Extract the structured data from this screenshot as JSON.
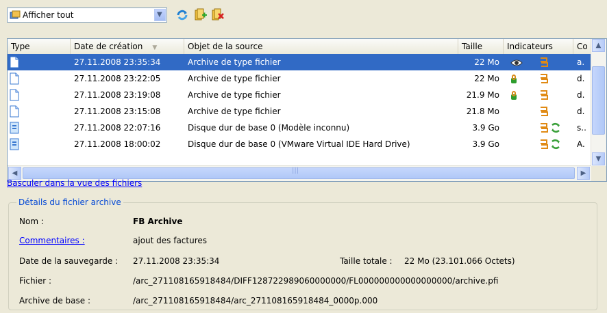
{
  "toolbar": {
    "filter_value": "Afficher tout",
    "icons": [
      "refresh-icon",
      "add-archive-icon",
      "delete-archive-icon"
    ]
  },
  "table": {
    "columns": [
      "Type",
      "Date de création",
      "Objet de la source",
      "Taille",
      "Indicateurs",
      "Co"
    ],
    "rows": [
      {
        "date": "27.11.2008 23:35:34",
        "object": "Archive de type fichier",
        "size": "22 Mo",
        "extra": "a.",
        "selected": true,
        "icon": "file-archive-icon",
        "indicators": [
          "hide-icon",
          "chain-icon"
        ]
      },
      {
        "date": "27.11.2008 23:22:05",
        "object": "Archive de type fichier",
        "size": "22 Mo",
        "extra": "d.",
        "selected": false,
        "icon": "file-archive-icon",
        "indicators": [
          "lock-icon",
          "chain-icon"
        ]
      },
      {
        "date": "27.11.2008 23:19:08",
        "object": "Archive de type fichier",
        "size": "21.9 Mo",
        "extra": "d.",
        "selected": false,
        "icon": "file-archive-icon",
        "indicators": [
          "lock-icon",
          "chain-icon"
        ]
      },
      {
        "date": "27.11.2008 23:15:08",
        "object": "Archive de type fichier",
        "size": "21.8 Mo",
        "extra": "d.",
        "selected": false,
        "icon": "file-archive-icon",
        "indicators": [
          "chain-icon"
        ]
      },
      {
        "date": "27.11.2008 22:07:16",
        "object": "Disque dur de base 0 (Modèle inconnu)",
        "size": "3.9 Go",
        "extra": "s..",
        "selected": false,
        "icon": "disk-archive-icon",
        "indicators": [
          "chain-icon",
          "recycle-icon"
        ]
      },
      {
        "date": "27.11.2008 18:00:02",
        "object": "Disque dur de base 0 (VMware Virtual IDE Hard Drive)",
        "size": "3.9 Go",
        "extra": "A.",
        "selected": false,
        "icon": "disk-archive-icon",
        "indicators": [
          "chain-icon",
          "recycle-icon"
        ]
      }
    ]
  },
  "switch_link": "Basculer dans la vue des fichiers",
  "details": {
    "title": "Détails du fichier archive",
    "name_label": "Nom :",
    "name_value": "FB Archive",
    "comments_label": "Commentaires :",
    "comments_value": "ajout des factures",
    "backup_date_label": "Date de la sauvegarde :",
    "backup_date_value": "27.11.2008 23:35:34",
    "total_size_label": "Taille totale :",
    "total_size_value": "22 Mo (23.101.066 Octets)",
    "file_label": "Fichier :",
    "file_value": "/arc_271108165918484/DIFF128722989060000000/FL000000000000000000/archive.pfi",
    "base_label": "Archive de base :",
    "base_value": "/arc_271108165918484/arc_271108165918484_0000p.000"
  },
  "colors": {
    "selection": "#316ac5",
    "link": "#0000ff",
    "group_title": "#0046d5"
  }
}
